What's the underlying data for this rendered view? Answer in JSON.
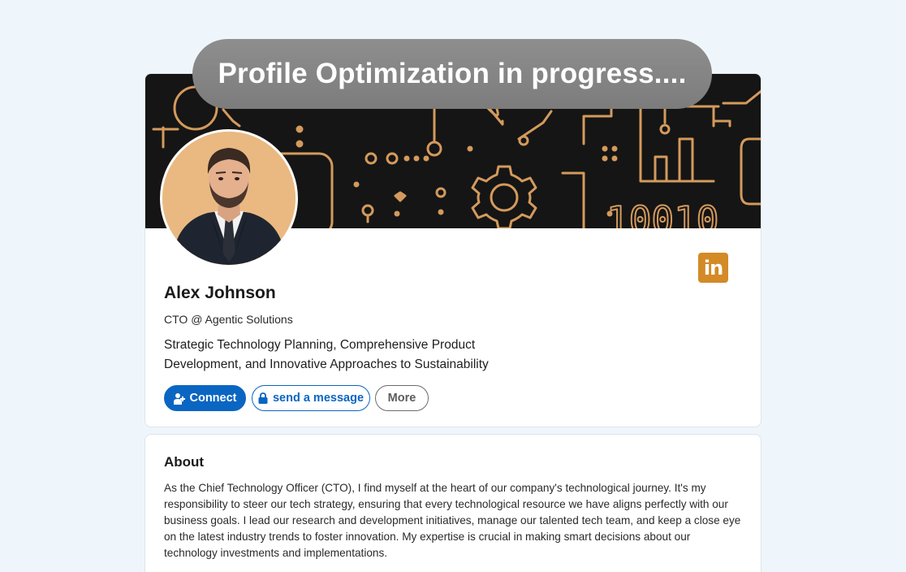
{
  "banner_text": "Profile Optimization in progress....",
  "profile": {
    "name": "Alex Johnson",
    "headline": "CTO @ Agentic Solutions",
    "tagline": "Strategic Technology Planning, Comprehensive Product Development, and Innovative Approaches to Sustainability"
  },
  "social_icon": {
    "name": "linkedin-icon",
    "glyph": "in"
  },
  "actions": {
    "connect_label": "Connect",
    "message_label": "send a message",
    "more_label": "More"
  },
  "about": {
    "title": "About",
    "text": "As the Chief Technology Officer (CTO), I find myself at the heart of our company's technological journey. It's my responsibility to steer our tech strategy, ensuring that every technological resource we have aligns perfectly with our business goals. I lead our research and development initiatives, manage our talented tech team, and keep a close eye on the latest industry trends to foster innovation. My expertise is crucial in making smart decisions about our technology investments and implementations."
  },
  "banner_decor": {
    "binary_text": "10010"
  },
  "colors": {
    "page_bg": "#eff6fb",
    "banner_bg": "#151515",
    "banner_lines": "#d49a5c",
    "accent_blue": "#0a66c2",
    "linkedin_orange": "#d38a27",
    "avatar_bg": "#eab982"
  }
}
